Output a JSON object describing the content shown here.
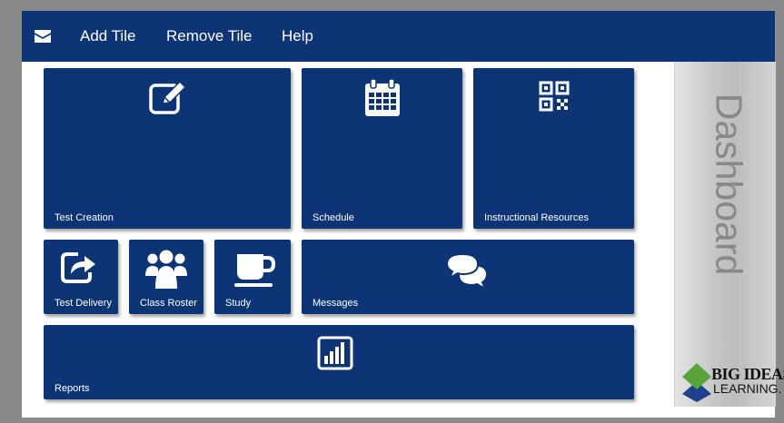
{
  "topbar": {
    "mail_icon": "envelope-icon",
    "menu": [
      {
        "label": "Add Tile"
      },
      {
        "label": "Remove Tile"
      },
      {
        "label": "Help"
      }
    ]
  },
  "tiles": {
    "test_creation": {
      "label": "Test Creation",
      "icon": "edit-icon"
    },
    "schedule": {
      "label": "Schedule",
      "icon": "calendar-icon"
    },
    "instructional_resources": {
      "label": "Instructional Resources",
      "icon": "qr-code-icon"
    },
    "test_delivery": {
      "label": "Test Delivery",
      "icon": "share-icon"
    },
    "class_roster": {
      "label": "Class Roster",
      "icon": "users-icon"
    },
    "study": {
      "label": "Study",
      "icon": "coffee-cup-icon"
    },
    "messages": {
      "label": "Messages",
      "icon": "chat-bubbles-icon"
    },
    "reports": {
      "label": "Reports",
      "icon": "bar-chart-icon"
    }
  },
  "sidebar": {
    "title": "Dashboard",
    "logo": {
      "line1": "BIG IDEAS",
      "line2": "LEARNING."
    }
  },
  "colors": {
    "tile": "#0d3576",
    "topbar": "#0d3576",
    "logo_green": "#5aa33a",
    "logo_blue": "#1f3f8f"
  }
}
